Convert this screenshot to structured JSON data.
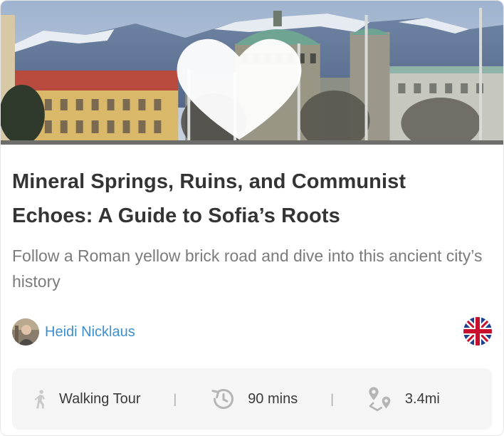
{
  "card": {
    "image_alt": "Sofia cityscape with domed church and mountains",
    "favorite_icon": "heart-icon",
    "title": "Mineral Springs, Ruins, and Communist Echoes: A Guide to Sofia’s Roots",
    "subtitle": "Follow a Roman yellow brick road and dive into this ancient city’s history",
    "author": {
      "name": "Heidi Nicklaus",
      "avatar_icon": "avatar"
    },
    "language_icon": "uk-flag-icon",
    "stats": {
      "tour_type": {
        "icon": "walking-person-icon",
        "label": "Walking Tour"
      },
      "duration": {
        "icon": "clock-history-icon",
        "label": "90 mins"
      },
      "distance": {
        "icon": "route-pin-icon",
        "label": "3.4mi"
      },
      "separator": "|"
    }
  },
  "colors": {
    "title": "#343434",
    "subtitle": "#7b7b7b",
    "author_link": "#3d8fcf",
    "stats_bg": "#f5f5f5"
  }
}
